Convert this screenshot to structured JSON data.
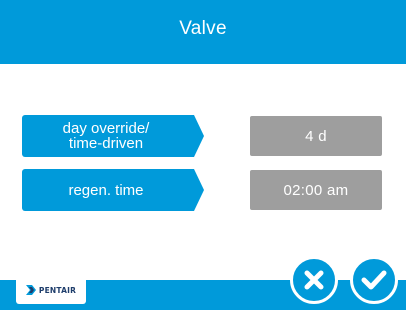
{
  "header": {
    "title": "Valve"
  },
  "settings": [
    {
      "label": "day override/\ntime-driven",
      "value": "4 d"
    },
    {
      "label": "regen. time",
      "value": "02:00 am"
    }
  ],
  "footer": {
    "logo_text": "PENTAIR",
    "cancel_icon": "close-icon",
    "confirm_icon": "check-icon"
  },
  "colors": {
    "accent": "#009ada",
    "value_box": "#9e9e9e",
    "background": "#ffffff",
    "logo_text": "#1e3d6b"
  }
}
